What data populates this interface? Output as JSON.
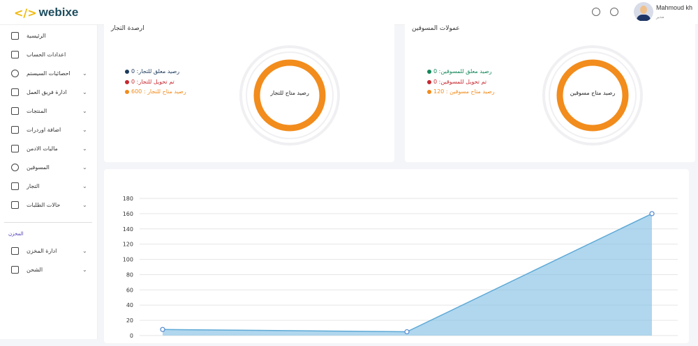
{
  "header": {
    "logo": "webixe",
    "user_name": "Mahmoud kh",
    "user_role": "مدير",
    "icons": [
      "bell-icon",
      "whatsapp-icon"
    ]
  },
  "sidebar": {
    "items": [
      {
        "label": "الرئيسية",
        "icon": "home-icon",
        "chevron": false
      },
      {
        "label": "اعدادات الحساب",
        "icon": "user-icon",
        "chevron": false
      },
      {
        "label": "احصائيات السيستم",
        "icon": "pie-chart-icon",
        "chevron": true
      },
      {
        "label": "ادارة فريق العمل",
        "icon": "table-icon",
        "chevron": true
      },
      {
        "label": "المنتجات",
        "icon": "archive-icon",
        "chevron": true
      },
      {
        "label": "اضافة اوردرات",
        "icon": "command-icon",
        "chevron": true
      },
      {
        "label": "ماليات الادمن",
        "icon": "calendar-icon",
        "chevron": true
      },
      {
        "label": "المسوقين",
        "icon": "pie-chart-icon",
        "chevron": true
      },
      {
        "label": "التجار",
        "icon": "bug-icon",
        "chevron": true
      },
      {
        "label": "حالات الطلبات",
        "icon": "file-icon",
        "chevron": true
      }
    ],
    "section": "المخزن",
    "section_items": [
      {
        "label": "ادارة المخزن",
        "icon": "pdf-icon"
      },
      {
        "label": "الشحن",
        "icon": "pdf-icon"
      }
    ]
  },
  "merchants": {
    "title": "ارصدة التجار",
    "center": "رصيد متاح للتجار",
    "legend": [
      {
        "text": "رصيد معلق للتجار: 0",
        "color": "#1b3a5c"
      },
      {
        "text": "تم تحويل للتجار: 0",
        "color": "#c6282f"
      },
      {
        "text": "رصيد متاح للتجار : 600",
        "color": "#f28c1c"
      }
    ],
    "values": [
      0,
      0,
      600
    ]
  },
  "marketers": {
    "title": "عمولات المسوقين",
    "center": "رصيد متاح مسوقين",
    "legend": [
      {
        "text": "رصيد معلق للمسوقين: 0",
        "color": "#14875a"
      },
      {
        "text": "تم تحويل للمسوقين: 0",
        "color": "#c6282f"
      },
      {
        "text": "رصيد متاح مسوقين : 120",
        "color": "#f28c1c"
      }
    ],
    "values": [
      0,
      0,
      120
    ]
  },
  "chart_data": {
    "type": "area",
    "y_ticks": [
      "0",
      "20",
      "40",
      "60",
      "80",
      "100",
      "120",
      "140",
      "160",
      "180"
    ],
    "ylim": [
      0,
      180
    ],
    "values": [
      8,
      5,
      160
    ],
    "color": "#7bbde2"
  }
}
